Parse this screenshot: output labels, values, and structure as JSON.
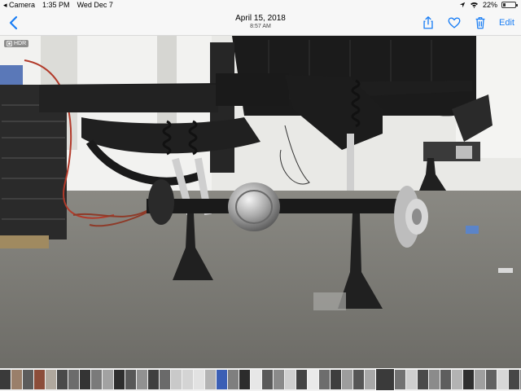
{
  "status_bar": {
    "back_app": "◂ Camera",
    "time": "1:35 PM",
    "date": "Wed Dec 7",
    "battery": "22%",
    "battery_level": 0.22
  },
  "nav": {
    "title": "April 15, 2018",
    "subtitle": "8:57 AM",
    "edit_label": "Edit",
    "accent_color": "#1a7ef5"
  },
  "photo": {
    "badge": "HDR",
    "subject_icon": "truck-chassis-photo"
  },
  "thumbnails": {
    "colors": [
      "#3a3a3a",
      "#9a7f6a",
      "#5c5c5c",
      "#8c4d3a",
      "#b0a89e",
      "#4a4a4a",
      "#6c6c6c",
      "#343434",
      "#7a7a7a",
      "#a2a2a2",
      "#2e2e2e",
      "#585858",
      "#919191",
      "#3f3f3f",
      "#6a6a6a",
      "#c9c9c9",
      "#d4d4d4",
      "#e2e2e2",
      "#b4b4b4",
      "#3b5fb5",
      "#7f7f7f",
      "#2c2c2c",
      "#e7e7e7",
      "#5a5a5a",
      "#8a8a8a",
      "#d0d0d0",
      "#444444",
      "#e9e9e9",
      "#6d6d6d",
      "#3e3e3e",
      "#9d9d9d",
      "#565656",
      "#a8a8a8",
      "#3a3a3a",
      "#727272",
      "#cfcfcf",
      "#4a4a4a",
      "#8b8b8b",
      "#5e5e5e",
      "#b3b3b3",
      "#2f2f2f",
      "#9f9f9f",
      "#616161",
      "#d7d7d7",
      "#474747",
      "#7e7e7e",
      "#aeaeae",
      "#3c3c3c",
      "#e0e0e0",
      "#686868",
      "#939393",
      "#cacaca"
    ]
  }
}
